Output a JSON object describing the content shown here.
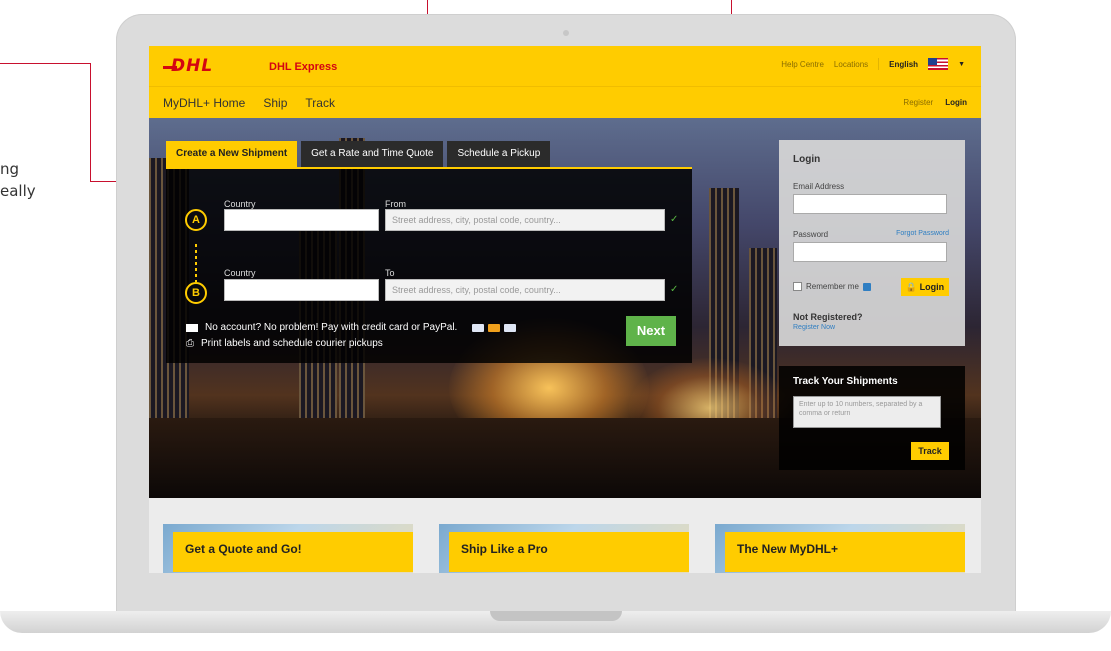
{
  "callout": {
    "line1": "ng",
    "line2": "eally"
  },
  "header": {
    "brand": "DHL Express",
    "logo_text": "DHL",
    "top_links": [
      "Help Centre",
      "Locations"
    ],
    "language": "English"
  },
  "nav": {
    "items": [
      "MyDHL+ Home",
      "Ship",
      "Track"
    ],
    "register": "Register",
    "login": "Login"
  },
  "tabs": [
    "Create a New Shipment",
    "Get a Rate and Time Quote",
    "Schedule a Pickup"
  ],
  "shipment": {
    "point_a": "A",
    "point_b": "B",
    "country_label": "Country",
    "from_label": "From",
    "to_label": "To",
    "address_placeholder": "Street address, city, postal code, country...",
    "info_pay": "No account? No problem! Pay with credit card or PayPal.",
    "info_print": "Print labels and schedule courier pickups",
    "next_button": "Next"
  },
  "login_panel": {
    "title": "Login",
    "email_label": "Email Address",
    "password_label": "Password",
    "forgot": "Forgot Password",
    "remember": "Remember me",
    "login_button": "Login",
    "not_registered": "Not Registered?",
    "register_now": "Register Now"
  },
  "track_panel": {
    "title": "Track Your Shipments",
    "placeholder": "Enter up to 10 numbers, separated by a comma or return",
    "button": "Track"
  },
  "cards": [
    "Get a Quote and Go!",
    "Ship Like a Pro",
    "The New MyDHL+"
  ],
  "colors": {
    "dhl_yellow": "#ffcc00",
    "dhl_red": "#d40511",
    "next_green": "#5fb34a",
    "link_blue": "#2f7ec2"
  }
}
